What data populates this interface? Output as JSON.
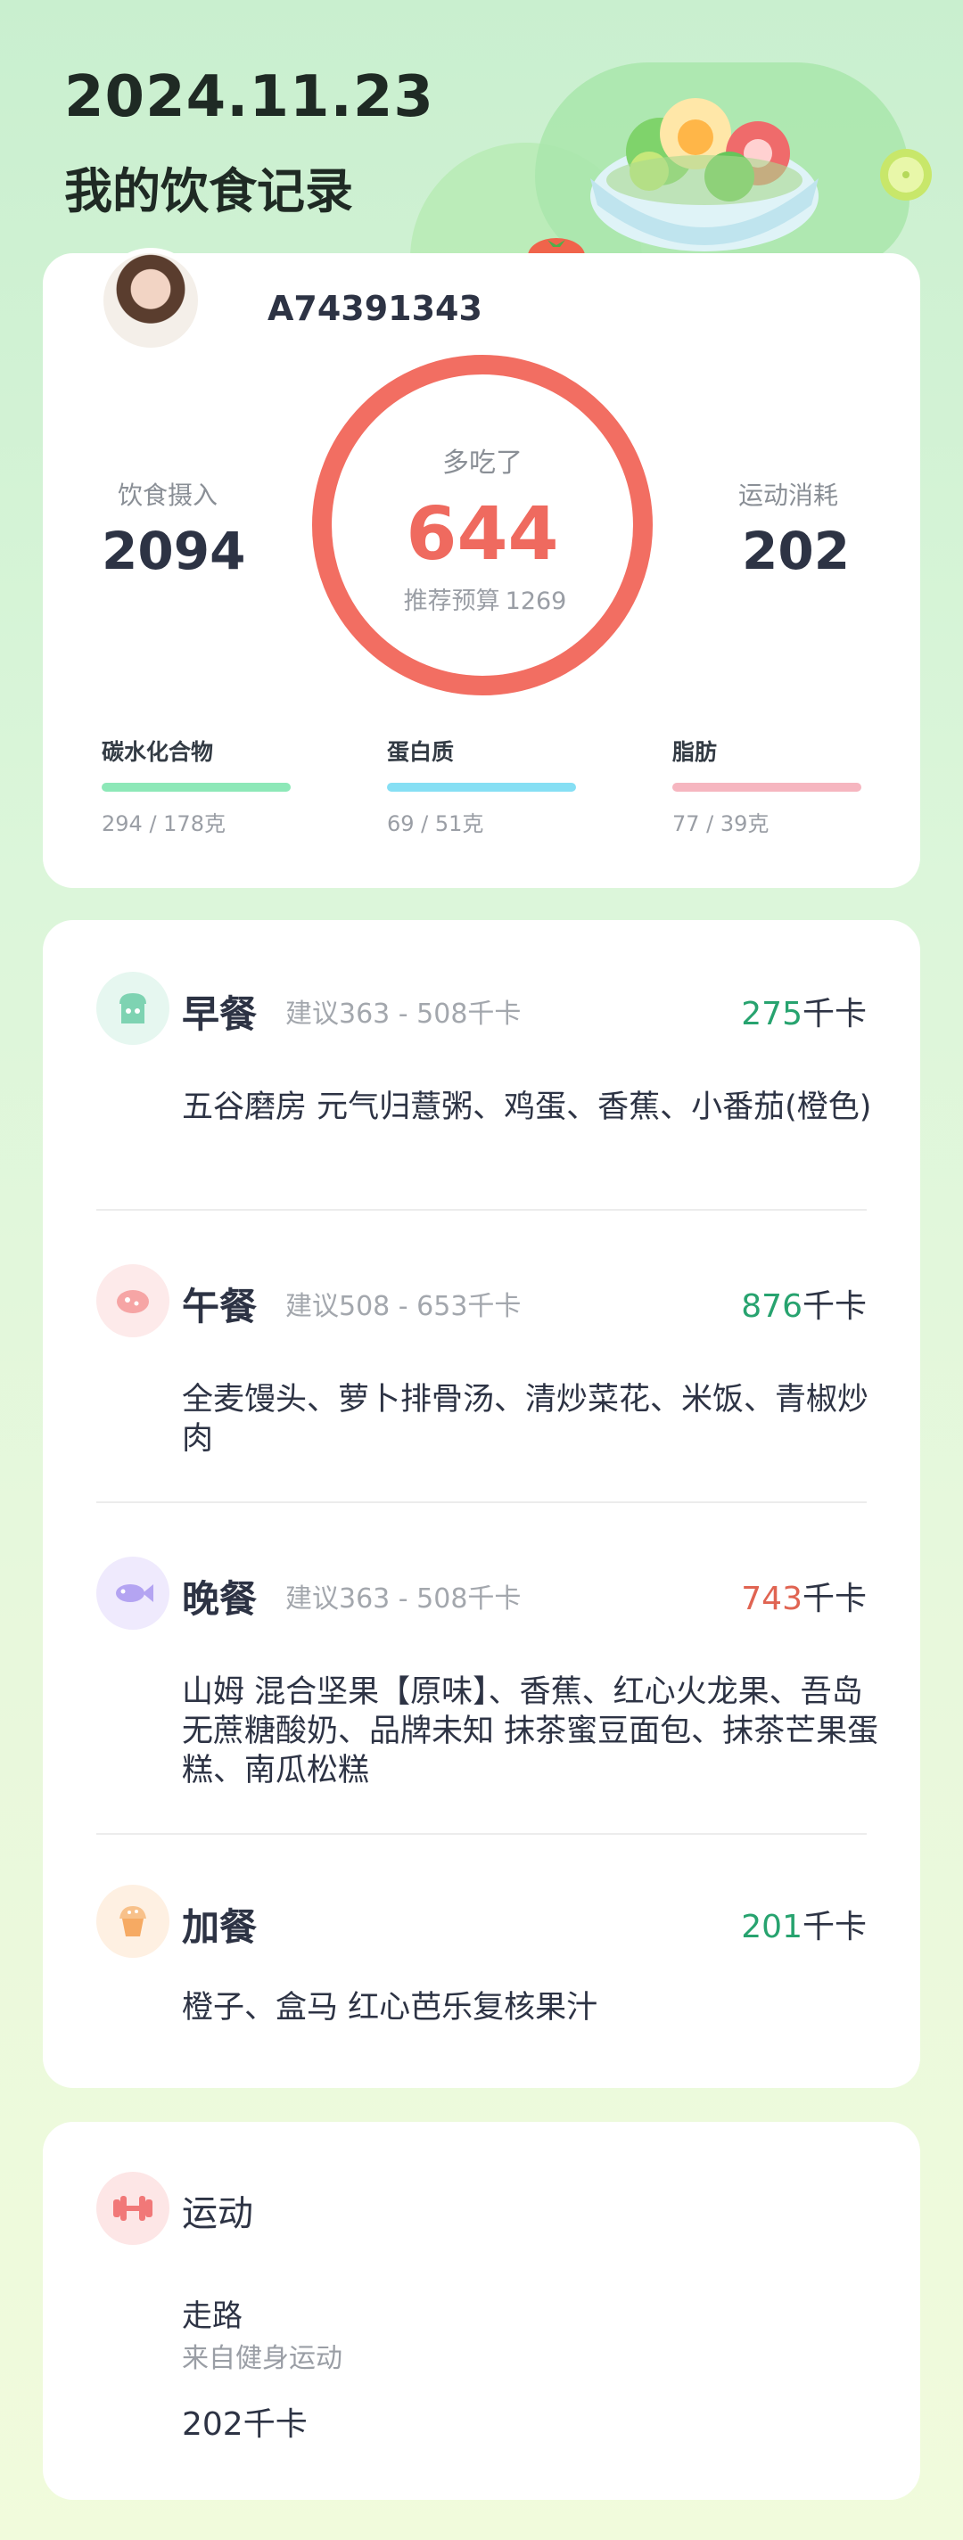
{
  "header": {
    "date": "2024.11.23",
    "title": "我的饮食记录"
  },
  "user": {
    "id": "A74391343"
  },
  "summary": {
    "intake_label": "饮食摄入",
    "intake_value": "2094",
    "burn_label": "运动消耗",
    "burn_value": "202",
    "ring_label": "多吃了",
    "ring_value": "644",
    "budget_label": "推荐预算",
    "budget_value": "1269",
    "ring_fraction": 1.0,
    "ring_color": "#f26e62"
  },
  "macros": [
    {
      "name": "碳水化合物",
      "value": "294 / 178克",
      "color": "#8de8b8"
    },
    {
      "name": "蛋白质",
      "value": "69 / 51克",
      "color": "#86dff4"
    },
    {
      "name": "脂肪",
      "value": "77 / 39克",
      "color": "#f6b6c0"
    }
  ],
  "meals": [
    {
      "name": "早餐",
      "suggest": "建议363 - 508千卡",
      "kcal_num": "275",
      "kcal_unit": "千卡",
      "kcal_color": "green",
      "icon": "toast-icon",
      "foods": "五谷磨房 元气归薏粥、鸡蛋、香蕉、小番茄(橙色)"
    },
    {
      "name": "午餐",
      "suggest": "建议508 - 653千卡",
      "kcal_num": "876",
      "kcal_unit": "千卡",
      "kcal_color": "green",
      "icon": "meat-icon",
      "foods": "全麦馒头、萝卜排骨汤、清炒菜花、米饭、青椒炒肉"
    },
    {
      "name": "晚餐",
      "suggest": "建议363 - 508千卡",
      "kcal_num": "743",
      "kcal_unit": "千卡",
      "kcal_color": "red",
      "icon": "fish-icon",
      "foods": "山姆 混合坚果【原味】、香蕉、红心火龙果、吾岛 无蔗糖酸奶、品牌未知 抹茶蜜豆面包、抹茶芒果蛋糕、南瓜松糕"
    },
    {
      "name": "加餐",
      "suggest": "",
      "kcal_num": "201",
      "kcal_unit": "千卡",
      "kcal_color": "green",
      "icon": "muffin-icon",
      "foods": "橙子、盒马 红心芭乐复核果汁"
    }
  ],
  "exercise": {
    "title": "运动",
    "name": "走路",
    "source": "来自健身运动",
    "kcal": "202千卡",
    "icon": "dumbbell-icon"
  }
}
